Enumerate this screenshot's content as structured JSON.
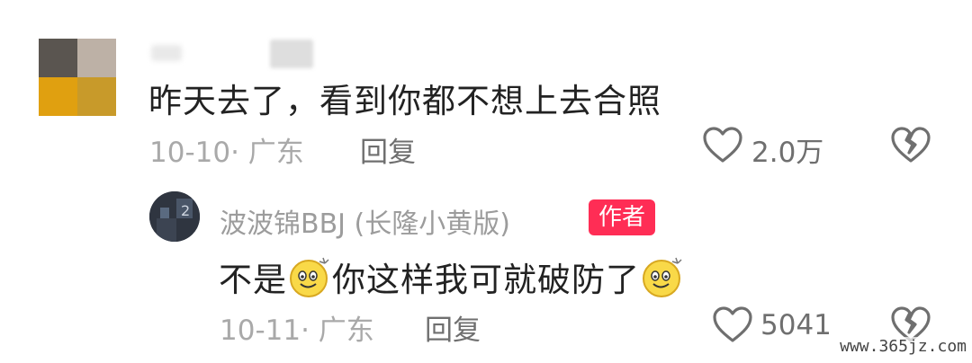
{
  "comment": {
    "text": "昨天去了，看到你都不想上去合照",
    "date_location": "10-10· 广东",
    "reply_label": "回复",
    "like_count": "2.0万",
    "avatar_colors": [
      "#5a5550",
      "#bdb1a6",
      "#e0a010",
      "#c89a2a"
    ]
  },
  "reply": {
    "author": "波波锦BBJ (长隆小黄版)",
    "author_badge": "作者",
    "text_part1": "不是",
    "text_part2": "你这样我可就破防了",
    "date_location": "10-11· 广东",
    "reply_label": "回复",
    "like_count": "5041"
  },
  "watermark": "www.365jz.com",
  "colors": {
    "badge": "#ff2d55",
    "text": "#222222",
    "meta": "#a9a9a9"
  }
}
